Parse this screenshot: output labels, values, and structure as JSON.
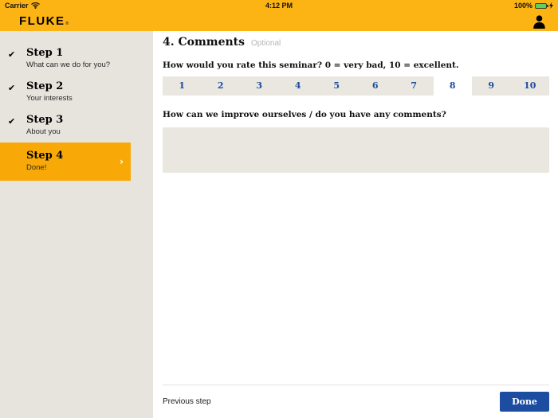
{
  "status_bar": {
    "carrier": "Carrier",
    "time": "4:12 PM",
    "battery_percent": "100%"
  },
  "header": {
    "logo": "FLUKE",
    "registered_mark": "®"
  },
  "sidebar": {
    "steps": [
      {
        "title": "Step 1",
        "subtitle": "What can we do for you?",
        "completed": true,
        "active": false
      },
      {
        "title": "Step 2",
        "subtitle": "Your interests",
        "completed": true,
        "active": false
      },
      {
        "title": "Step 3",
        "subtitle": "About you",
        "completed": true,
        "active": false
      },
      {
        "title": "Step 4",
        "subtitle": "Done!",
        "completed": false,
        "active": true
      }
    ],
    "check_glyph": "✔",
    "chevron_glyph": "›"
  },
  "main": {
    "title": "4. Comments",
    "title_badge": "Optional",
    "rating_question": "How would you rate this seminar? 0 = very bad, 10 = excellent.",
    "rating_options": [
      "1",
      "2",
      "3",
      "4",
      "5",
      "6",
      "7",
      "8",
      "9",
      "10"
    ],
    "rating_selected": "8",
    "comments_question": "How can we improve ourselves / do you have any comments?",
    "comments_value": "",
    "footer": {
      "previous_label": "Previous step",
      "done_label": "Done"
    }
  },
  "colors": {
    "brand_yellow": "#fcb415",
    "active_amber": "#f9a907",
    "sidebar_bg": "#e7e4de",
    "control_beige": "#eae7e0",
    "accent_blue": "#1c4da0",
    "battery_green": "#5fd05f",
    "muted_gray": "#b5b5b5"
  }
}
